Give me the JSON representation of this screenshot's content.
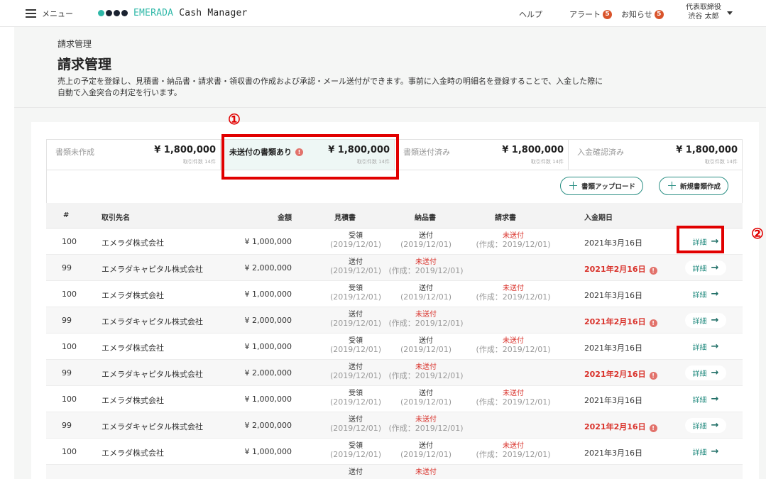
{
  "header": {
    "menu_label": "メニュー",
    "brand_prefix": "EMERADA",
    "brand_suffix": " Cash Manager",
    "help": "ヘルプ",
    "alert": "アラート",
    "alert_count": "5",
    "notice": "お知らせ",
    "notice_count": "5",
    "user_role": "代表取締役",
    "user_name": "渋谷 太郎"
  },
  "page": {
    "breadcrumb": "請求管理",
    "title": "請求管理",
    "description_line1": "売上の予定を登録し、見積書・納品書・請求書・領収書の作成および承認・メール送付ができます。事前に入金時の明細名を登録することで、入金した際に",
    "description_line2": "自動で入金突合の判定を行います。"
  },
  "annotations": {
    "marker1": "①",
    "marker2": "②",
    "highlight_color": "#e10000"
  },
  "status_cards": [
    {
      "label": "書類未作成",
      "amount": "¥ 1,800,000",
      "count": "取引件数 14件",
      "active": false,
      "warning": false
    },
    {
      "label": "未送付の書類あり",
      "amount": "¥ 1,800,000",
      "count": "取引件数 14件",
      "active": true,
      "warning": true
    },
    {
      "label": "書類送付済み",
      "amount": "¥ 1,800,000",
      "count": "取引件数 14件",
      "active": false,
      "warning": false
    },
    {
      "label": "入金確認済み",
      "amount": "¥ 1,800,000",
      "count": "取引件数 14件",
      "active": false,
      "warning": false
    }
  ],
  "toolbar": {
    "upload_label": "書類アップロード",
    "new_label": "新規書類作成",
    "accent": "#2b8f84"
  },
  "table": {
    "columns": [
      "#",
      "取引先名",
      "金額",
      "見積書",
      "納品書",
      "請求書",
      "入金期日"
    ],
    "detail_label": "詳細",
    "rows": [
      {
        "num": "100",
        "client": "エメラダ株式会社",
        "amount": "¥ 1,000,000",
        "d1s": "受領",
        "d1d": "(2019/12/01)",
        "d2s": "送付",
        "d2d": "(2019/12/01)",
        "d3s": "未送付",
        "d3d": "(作成：2019/12/01)",
        "due": "2021年3月16日",
        "overdue": false
      },
      {
        "num": "99",
        "client": "エメラダキャピタル株式会社",
        "amount": "¥ 2,000,000",
        "d1s": "送付",
        "d1d": "(2019/12/01)",
        "d2s": "未送付",
        "d2d": "(作成：2019/12/01)",
        "d3s": "",
        "d3d": "",
        "due": "2021年2月16日",
        "overdue": true
      },
      {
        "num": "100",
        "client": "エメラダ株式会社",
        "amount": "¥ 1,000,000",
        "d1s": "受領",
        "d1d": "(2019/12/01)",
        "d2s": "送付",
        "d2d": "(2019/12/01)",
        "d3s": "未送付",
        "d3d": "(作成：2019/12/01)",
        "due": "2021年3月16日",
        "overdue": false
      },
      {
        "num": "99",
        "client": "エメラダキャピタル株式会社",
        "amount": "¥ 2,000,000",
        "d1s": "送付",
        "d1d": "(2019/12/01)",
        "d2s": "未送付",
        "d2d": "(作成：2019/12/01)",
        "d3s": "",
        "d3d": "",
        "due": "2021年2月16日",
        "overdue": true
      },
      {
        "num": "100",
        "client": "エメラダ株式会社",
        "amount": "¥ 1,000,000",
        "d1s": "受領",
        "d1d": "(2019/12/01)",
        "d2s": "送付",
        "d2d": "(2019/12/01)",
        "d3s": "未送付",
        "d3d": "(作成：2019/12/01)",
        "due": "2021年3月16日",
        "overdue": false
      },
      {
        "num": "99",
        "client": "エメラダキャピタル株式会社",
        "amount": "¥ 2,000,000",
        "d1s": "送付",
        "d1d": "(2019/12/01)",
        "d2s": "未送付",
        "d2d": "(作成：2019/12/01)",
        "d3s": "",
        "d3d": "",
        "due": "2021年2月16日",
        "overdue": true
      },
      {
        "num": "100",
        "client": "エメラダ株式会社",
        "amount": "¥ 1,000,000",
        "d1s": "受領",
        "d1d": "(2019/12/01)",
        "d2s": "送付",
        "d2d": "(2019/12/01)",
        "d3s": "未送付",
        "d3d": "(作成：2019/12/01)",
        "due": "2021年3月16日",
        "overdue": false
      },
      {
        "num": "99",
        "client": "エメラダキャピタル株式会社",
        "amount": "¥ 2,000,000",
        "d1s": "送付",
        "d1d": "(2019/12/01)",
        "d2s": "未送付",
        "d2d": "(作成：2019/12/01)",
        "d3s": "",
        "d3d": "",
        "due": "2021年2月16日",
        "overdue": true
      },
      {
        "num": "100",
        "client": "エメラダ株式会社",
        "amount": "¥ 1,000,000",
        "d1s": "受領",
        "d1d": "(2019/12/01)",
        "d2s": "送付",
        "d2d": "(2019/12/01)",
        "d3s": "未送付",
        "d3d": "(作成：2019/12/01)",
        "due": "2021年3月16日",
        "overdue": false
      },
      {
        "num": "",
        "client": "",
        "amount": "",
        "d1s": "送付",
        "d1d": "",
        "d2s": "未送付",
        "d2d": "",
        "d3s": "",
        "d3d": "",
        "due": "",
        "overdue": false
      }
    ]
  }
}
